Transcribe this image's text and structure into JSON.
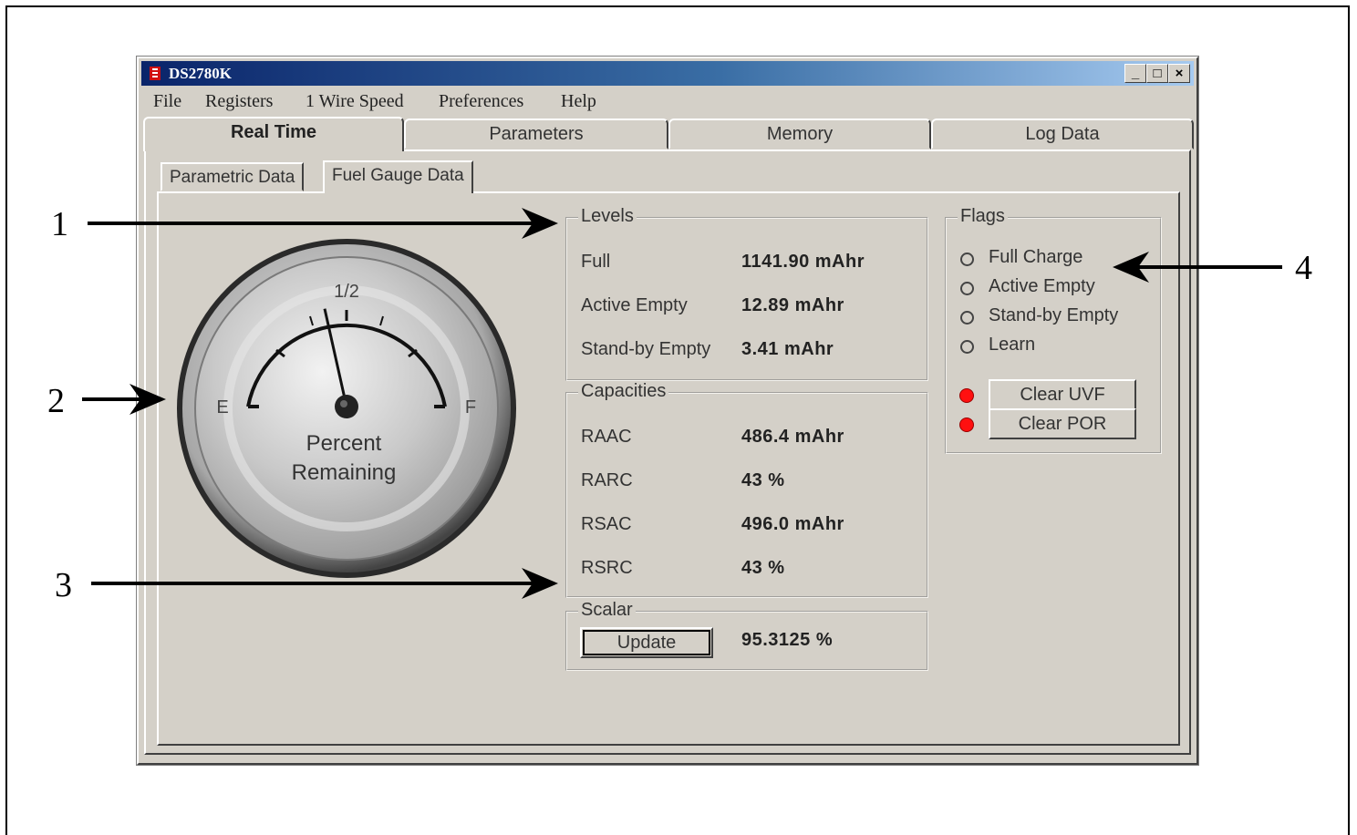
{
  "callouts": [
    "1",
    "2",
    "3",
    "4"
  ],
  "window": {
    "title": "DS2780K",
    "controls": {
      "minimize": "_",
      "maximize": "□",
      "close": "×"
    }
  },
  "menu": [
    {
      "label": "File"
    },
    {
      "label": "Registers"
    },
    {
      "label": "1 Wire Speed"
    },
    {
      "label": "Preferences"
    },
    {
      "label": "Help"
    }
  ],
  "tabs": [
    {
      "label": "Real Time",
      "active": true
    },
    {
      "label": "Parameters"
    },
    {
      "label": "Memory"
    },
    {
      "label": "Log Data"
    }
  ],
  "subtabs": [
    {
      "label": "Parametric Data"
    },
    {
      "label": "Fuel Gauge Data",
      "active": true
    }
  ],
  "gauge": {
    "half_label": "1/2",
    "empty_label": "E",
    "full_label": "F",
    "caption_line1": "Percent",
    "caption_line2": "Remaining",
    "percent": 43
  },
  "levels": {
    "title": "Levels",
    "rows": [
      {
        "label": "Full",
        "value": "1141.90 mAhr"
      },
      {
        "label": "Active Empty",
        "value": "12.89 mAhr"
      },
      {
        "label": "Stand-by Empty",
        "value": "3.41 mAhr"
      }
    ]
  },
  "capacities": {
    "title": "Capacities",
    "rows": [
      {
        "label": "RAAC",
        "value": "486.4 mAhr"
      },
      {
        "label": "RARC",
        "value": "43 %"
      },
      {
        "label": "RSAC",
        "value": "496.0 mAhr"
      },
      {
        "label": "RSRC",
        "value": "43 %"
      }
    ]
  },
  "scalar": {
    "title": "Scalar",
    "update_label": "Update",
    "value": "95.3125 %"
  },
  "flags": {
    "title": "Flags",
    "items": [
      {
        "label": "Full Charge"
      },
      {
        "label": "Active Empty"
      },
      {
        "label": "Stand-by Empty"
      },
      {
        "label": "Learn"
      }
    ],
    "buttons": [
      {
        "label": "Clear UVF",
        "led_color": "#ff1010"
      },
      {
        "label": "Clear POR",
        "led_color": "#ff1010"
      }
    ]
  }
}
